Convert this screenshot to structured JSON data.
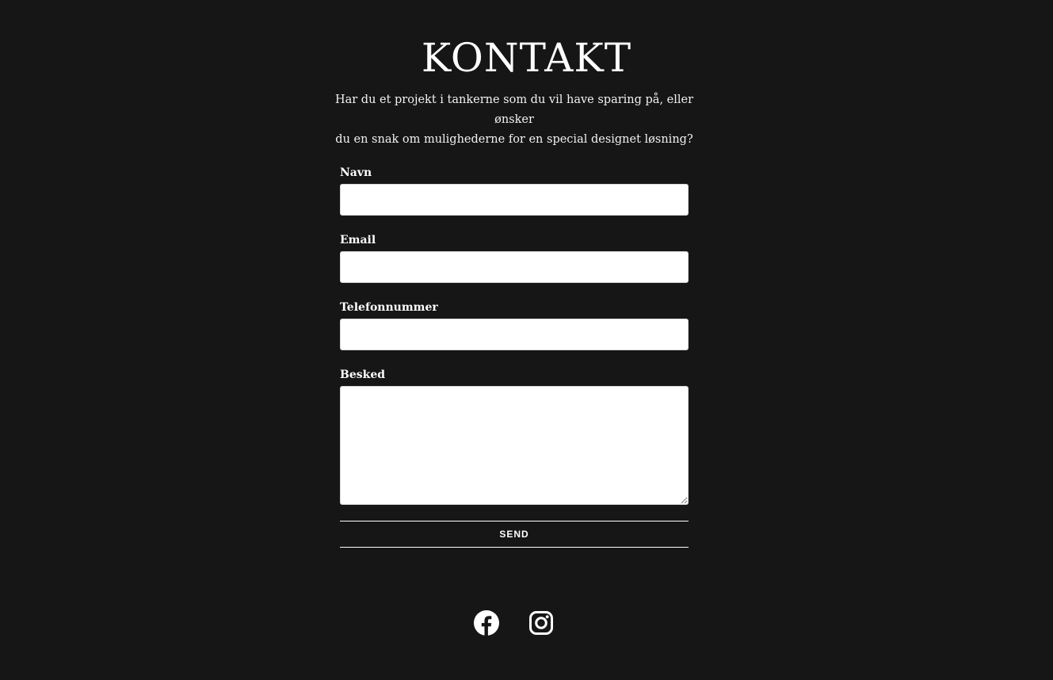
{
  "header": {
    "title": "KONTAKT",
    "intro_line1": "Har du et projekt i tankerne som du vil have sparing på, eller ønsker",
    "intro_line2": "du en snak om mulighederne for en special designet løsning?"
  },
  "form": {
    "fields": [
      {
        "label": "Navn",
        "value": ""
      },
      {
        "label": "Email",
        "value": ""
      },
      {
        "label": "Telefonnummer",
        "value": ""
      },
      {
        "label": "Besked",
        "value": ""
      }
    ],
    "submit_label": "SEND"
  },
  "social": {
    "icons": [
      "facebook-icon",
      "instagram-icon"
    ]
  },
  "colors": {
    "background": "#161616",
    "text": "#ffffff",
    "input_background": "#ffffff"
  }
}
